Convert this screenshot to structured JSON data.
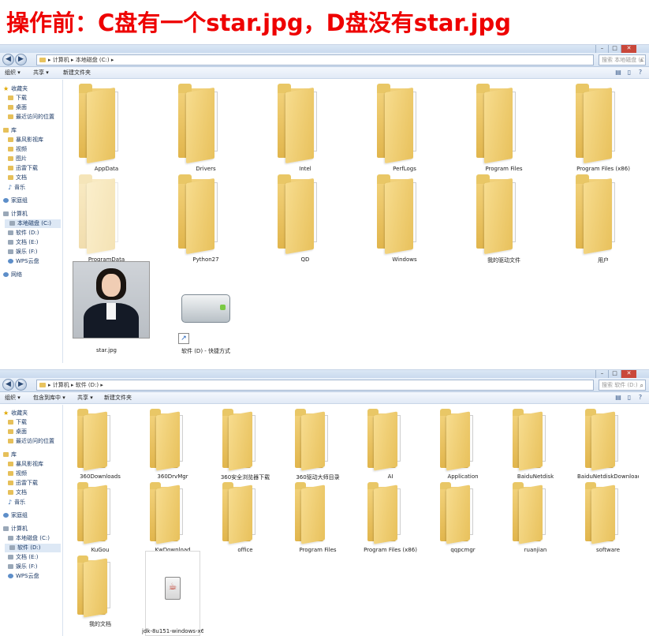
{
  "banner": {
    "text": "操作前：C盘有一个star.jpg，D盘没有star.jpg"
  },
  "window1": {
    "address": "▸ 计算机 ▸ 本地磁盘 (C:) ▸",
    "search_placeholder": "搜索 本地磁盘 (C:)",
    "toolbar": {
      "organize": "组织 ▾",
      "share": "共享 ▾",
      "new_folder": "新建文件夹"
    },
    "sidebar": [
      {
        "label": "收藏夹",
        "icon": "star-icon",
        "header": true
      },
      {
        "label": "下载",
        "icon": "folder-icon"
      },
      {
        "label": "桌面",
        "icon": "folder-icon"
      },
      {
        "label": "最近访问的位置",
        "icon": "folder-icon"
      },
      {
        "label": "库",
        "icon": "folder-icon",
        "header": true
      },
      {
        "label": "暴风影视库",
        "icon": "folder-icon"
      },
      {
        "label": "视频",
        "icon": "folder-icon"
      },
      {
        "label": "图片",
        "icon": "folder-icon"
      },
      {
        "label": "迅雷下载",
        "icon": "folder-icon"
      },
      {
        "label": "文档",
        "icon": "folder-icon"
      },
      {
        "label": "音乐",
        "icon": "music-icon"
      },
      {
        "label": "家庭组",
        "icon": "network-icon",
        "header": true
      },
      {
        "label": "计算机",
        "icon": "drive-icon",
        "header": true
      },
      {
        "label": "本地磁盘 (C:)",
        "icon": "drive-icon",
        "selected": true
      },
      {
        "label": "软件 (D:)",
        "icon": "drive-icon"
      },
      {
        "label": "文档 (E:)",
        "icon": "drive-icon"
      },
      {
        "label": "娱乐 (F:)",
        "icon": "drive-icon"
      },
      {
        "label": "WPS云盘",
        "icon": "network-icon"
      },
      {
        "label": "网络",
        "icon": "network-icon",
        "header": true
      }
    ],
    "items": [
      {
        "label": "AppData",
        "kind": "folder"
      },
      {
        "label": "Drivers",
        "kind": "folder"
      },
      {
        "label": "Intel",
        "kind": "folder"
      },
      {
        "label": "PerfLogs",
        "kind": "folder"
      },
      {
        "label": "Program Files",
        "kind": "folder"
      },
      {
        "label": "Program Files (x86)",
        "kind": "folder"
      },
      {
        "label": "ProgramData",
        "kind": "folder-faded"
      },
      {
        "label": "Python27",
        "kind": "folder-docs"
      },
      {
        "label": "QD",
        "kind": "folder"
      },
      {
        "label": "Windows",
        "kind": "folder-blue"
      },
      {
        "label": "我的驱动文件",
        "kind": "folder"
      },
      {
        "label": "用户",
        "kind": "folder"
      },
      {
        "label": "star.jpg",
        "kind": "photo"
      },
      {
        "label": "软件 (D) - 快捷方式",
        "kind": "drive-shortcut"
      }
    ]
  },
  "window2": {
    "address": "▸ 计算机 ▸ 软件 (D:) ▸",
    "search_placeholder": "搜索 软件 (D:)",
    "toolbar": {
      "organize": "组织 ▾",
      "include": "包含到库中 ▾",
      "share": "共享 ▾",
      "new_folder": "新建文件夹"
    },
    "sidebar": [
      {
        "label": "收藏夹",
        "icon": "star-icon",
        "header": true
      },
      {
        "label": "下载",
        "icon": "folder-icon"
      },
      {
        "label": "桌面",
        "icon": "folder-icon"
      },
      {
        "label": "最近访问的位置",
        "icon": "folder-icon"
      },
      {
        "label": "库",
        "icon": "folder-icon",
        "header": true
      },
      {
        "label": "暴风影视库",
        "icon": "folder-icon"
      },
      {
        "label": "视频",
        "icon": "folder-icon"
      },
      {
        "label": "迅雷下载",
        "icon": "folder-icon"
      },
      {
        "label": "文档",
        "icon": "folder-icon"
      },
      {
        "label": "音乐",
        "icon": "music-icon"
      },
      {
        "label": "家庭组",
        "icon": "network-icon",
        "header": true
      },
      {
        "label": "计算机",
        "icon": "drive-icon",
        "header": true
      },
      {
        "label": "本地磁盘 (C:)",
        "icon": "drive-icon"
      },
      {
        "label": "软件 (D:)",
        "icon": "drive-icon",
        "selected": true
      },
      {
        "label": "文档 (E:)",
        "icon": "drive-icon"
      },
      {
        "label": "娱乐 (F:)",
        "icon": "drive-icon"
      },
      {
        "label": "WPS云盘",
        "icon": "network-icon"
      }
    ],
    "items": [
      {
        "label": "360Downloads",
        "kind": "folder"
      },
      {
        "label": "360DrvMgr",
        "kind": "folder-blue"
      },
      {
        "label": "360安全浏览器下载",
        "kind": "folder-docs"
      },
      {
        "label": "360驱动大师目录",
        "kind": "folder"
      },
      {
        "label": "AI",
        "kind": "folder-face"
      },
      {
        "label": "Application",
        "kind": "folder"
      },
      {
        "label": "BaiduNetdisk",
        "kind": "folder-blue"
      },
      {
        "label": "BaiduNetdiskDownload",
        "kind": "folder-colorful"
      },
      {
        "label": "KuGou",
        "kind": "folder-blue"
      },
      {
        "label": "KwDownload",
        "kind": "folder"
      },
      {
        "label": "office",
        "kind": "folder"
      },
      {
        "label": "Program Files",
        "kind": "folder-empty"
      },
      {
        "label": "Program Files (x86)",
        "kind": "folder-blue"
      },
      {
        "label": "qqpcmgr",
        "kind": "folder-docs"
      },
      {
        "label": "ruanjian",
        "kind": "folder"
      },
      {
        "label": "software",
        "kind": "folder-docs"
      },
      {
        "label": "我的文档",
        "kind": "folder-docs"
      },
      {
        "label": "jdk-8u151-windows-x64.exe",
        "kind": "jdk"
      }
    ]
  }
}
